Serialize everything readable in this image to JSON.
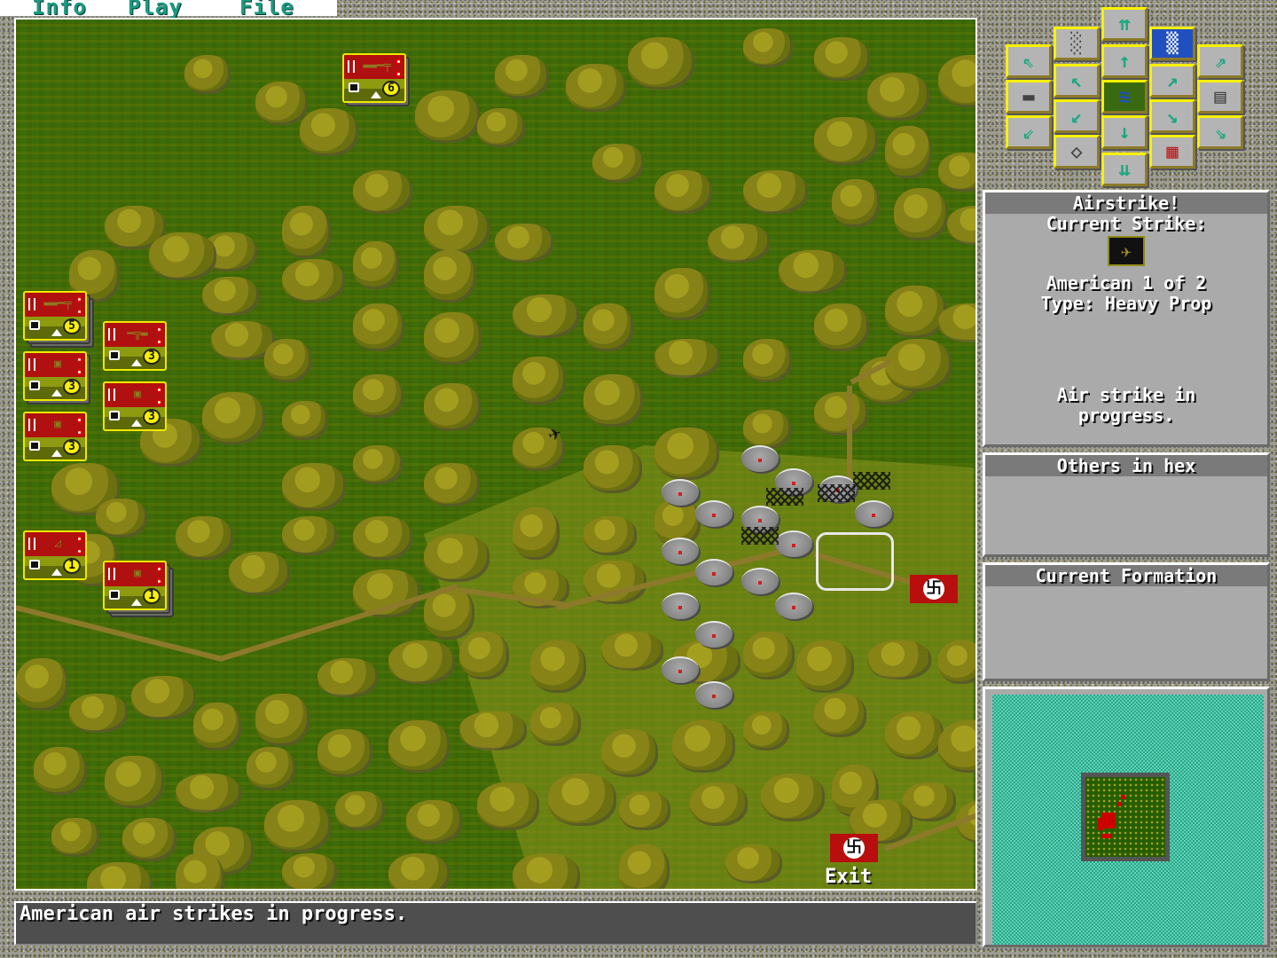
{
  "menu": {
    "items": [
      "Info",
      "Play",
      "File"
    ]
  },
  "toolbar": {
    "buttons": [
      {
        "name": "scroll-up-fast",
        "icon": "double-up-arrow-icon",
        "glyph": "⇈"
      },
      {
        "name": "scroll-up",
        "icon": "up-arrow-icon",
        "glyph": "↑"
      },
      {
        "name": "strategic-map",
        "icon": "map-icon",
        "glyph": "≋"
      },
      {
        "name": "scroll-down",
        "icon": "down-arrow-icon",
        "glyph": "↓"
      },
      {
        "name": "scroll-down-fast",
        "icon": "double-down-arrow-icon",
        "glyph": "⇊"
      },
      {
        "name": "toggle-hexgrid",
        "icon": "hex-grid-icon",
        "glyph": "░"
      },
      {
        "name": "scroll-up-left",
        "icon": "up-left-arrow-icon",
        "glyph": "↖"
      },
      {
        "name": "scroll-down-left",
        "icon": "down-left-arrow-icon",
        "glyph": "↙"
      },
      {
        "name": "center-view",
        "icon": "crosshair-icon",
        "glyph": "◇"
      },
      {
        "name": "weather",
        "icon": "terrain-view-icon",
        "glyph": "▒"
      },
      {
        "name": "scroll-up-right",
        "icon": "up-right-arrow-icon",
        "glyph": "↗"
      },
      {
        "name": "scroll-down-right",
        "icon": "down-right-arrow-icon",
        "glyph": "↘"
      },
      {
        "name": "minefield",
        "icon": "minefield-icon",
        "glyph": "▦"
      },
      {
        "name": "scroll-up-left-fast",
        "icon": "double-up-left-arrow-icon",
        "glyph": "⇖"
      },
      {
        "name": "unit-view",
        "icon": "tank-icon",
        "glyph": "▬"
      },
      {
        "name": "scroll-down-left-fast",
        "icon": "double-down-left-arrow-icon",
        "glyph": "⇙"
      },
      {
        "name": "scroll-up-right-fast",
        "icon": "double-up-right-arrow-icon",
        "glyph": "⇗"
      },
      {
        "name": "notes",
        "icon": "document-icon",
        "glyph": "▤"
      },
      {
        "name": "scroll-down-right-fast",
        "icon": "double-down-right-arrow-icon",
        "glyph": "⇘"
      }
    ]
  },
  "airstrike_panel": {
    "title": "Airstrike!",
    "subtitle": "Current Strike:",
    "strike_icon": "plane-icon",
    "line1": "American 1 of 2",
    "line2": "Type: Heavy Prop",
    "status": "Air strike in\nprogress."
  },
  "others_panel": {
    "title": "Others in hex"
  },
  "formation_panel": {
    "title": "Current Formation"
  },
  "message_bar": {
    "text": "American air strikes in progress."
  },
  "map": {
    "exit_label": "Exit",
    "counters": [
      {
        "id": "rifle-6",
        "type": "infantry",
        "strength": "6"
      },
      {
        "id": "rifle-5",
        "type": "infantry",
        "strength": "5"
      },
      {
        "id": "mg-3",
        "type": "machine-gun",
        "strength": "3"
      },
      {
        "id": "armor-3a",
        "type": "armor",
        "strength": "3"
      },
      {
        "id": "armor-3b",
        "type": "armor",
        "strength": "3"
      },
      {
        "id": "armor-3c",
        "type": "armor",
        "strength": "3"
      },
      {
        "id": "artillery-1",
        "type": "artillery",
        "strength": "1"
      },
      {
        "id": "armor-1",
        "type": "armor",
        "strength": "1"
      }
    ],
    "flag_glyph": "卐"
  },
  "colors": {
    "menu_text": "#1a9a82",
    "counter_red": "#b01010",
    "highlight_yellow": "#f8f000",
    "sea": "#40c0a0"
  }
}
